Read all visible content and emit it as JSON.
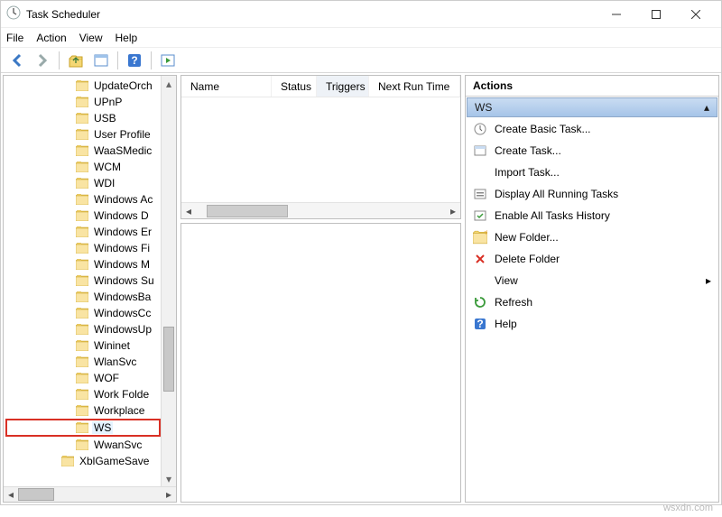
{
  "window": {
    "title": "Task Scheduler"
  },
  "menu": {
    "file": "File",
    "action": "Action",
    "view": "View",
    "help": "Help"
  },
  "tree": {
    "items": [
      "UpdateOrch",
      "UPnP",
      "USB",
      "User Profile",
      "WaaSMedic",
      "WCM",
      "WDI",
      "Windows Ac",
      "Windows D",
      "Windows Er",
      "Windows Fi",
      "Windows M",
      "Windows Su",
      "WindowsBa",
      "WindowsCc",
      "WindowsUp",
      "Wininet",
      "WlanSvc",
      "WOF",
      "Work Folde",
      "Workplace ",
      "WS",
      "WwanSvc"
    ],
    "lastItem": "XblGameSave"
  },
  "taskHeaders": {
    "name": "Name",
    "status": "Status",
    "triggers": "Triggers",
    "nextRun": "Next Run Time"
  },
  "actionsPane": {
    "title": "Actions",
    "section": "WS",
    "items": [
      "Create Basic Task...",
      "Create Task...",
      "Import Task...",
      "Display All Running Tasks",
      "Enable All Tasks History",
      "New Folder...",
      "Delete Folder",
      "View",
      "Refresh",
      "Help"
    ]
  },
  "watermark": "wsxdn.com"
}
